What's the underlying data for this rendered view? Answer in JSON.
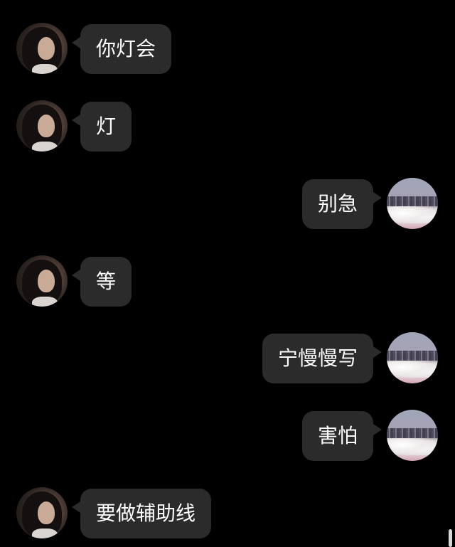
{
  "messages": [
    {
      "side": "left",
      "text": "你灯会"
    },
    {
      "side": "left",
      "text": "灯"
    },
    {
      "side": "right",
      "text": "别急"
    },
    {
      "side": "left",
      "text": "等"
    },
    {
      "side": "right",
      "text": "宁慢慢写"
    },
    {
      "side": "right",
      "text": "害怕"
    },
    {
      "side": "left",
      "text": "要做辅助线"
    }
  ],
  "colors": {
    "background": "#000000",
    "bubble": "#2b2b2b",
    "text": "#ffffff"
  }
}
